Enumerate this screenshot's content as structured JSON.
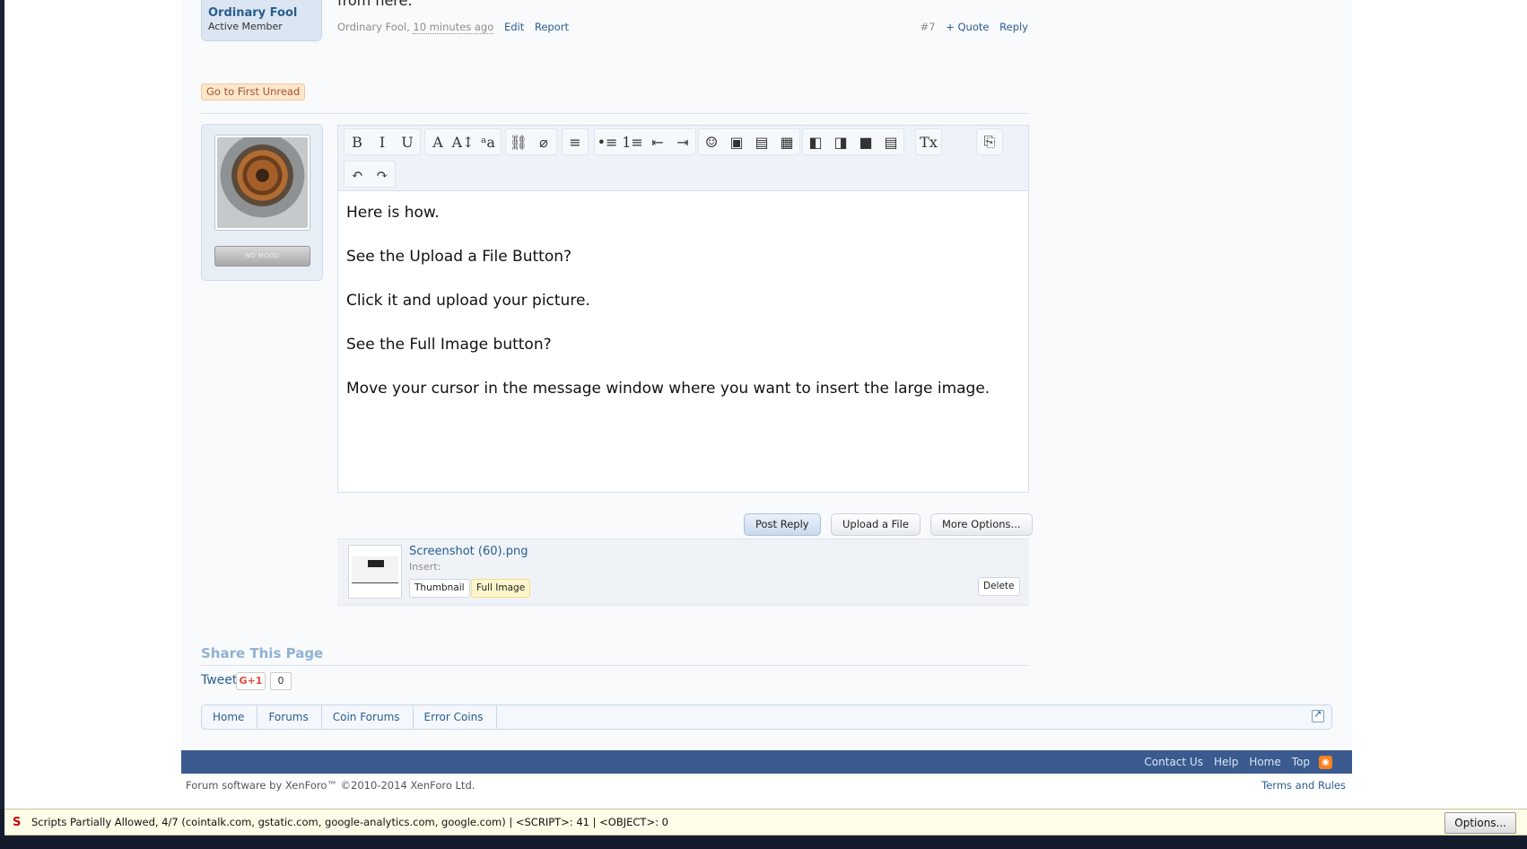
{
  "previous_post": {
    "username": "Ordinary Fool",
    "user_title": "Active Member",
    "cut_text": "from here.",
    "author": "Ordinary Fool,",
    "time": "10 minutes ago",
    "edit": "Edit",
    "report": "Report",
    "post_number": "#7",
    "quote": "+ Quote",
    "reply": "Reply"
  },
  "go_first_unread": "Go to First Unread",
  "quick_reply": {
    "mood_label": "NO MOOD",
    "toolbar_row1": [
      {
        "icon": "bold-icon",
        "glyph": "B"
      },
      {
        "icon": "italic-icon",
        "glyph": "I"
      },
      {
        "icon": "underline-icon",
        "glyph": "U"
      },
      {
        "icon": "text-color-icon",
        "glyph": "A"
      },
      {
        "icon": "font-size-icon",
        "glyph": "A↕"
      },
      {
        "icon": "font-family-icon",
        "glyph": "ᵃa"
      },
      {
        "icon": "link-icon",
        "glyph": "⛓"
      },
      {
        "icon": "unlink-icon",
        "glyph": "⌀"
      },
      {
        "icon": "align-icon",
        "glyph": "≡"
      },
      {
        "icon": "bullet-list-icon",
        "glyph": "•≡"
      },
      {
        "icon": "number-list-icon",
        "glyph": "1≡"
      },
      {
        "icon": "outdent-icon",
        "glyph": "⇤"
      },
      {
        "icon": "indent-icon",
        "glyph": "⇥"
      },
      {
        "icon": "smilie-icon",
        "glyph": "☺"
      },
      {
        "icon": "image-icon",
        "glyph": "▣"
      },
      {
        "icon": "media-icon",
        "glyph": "▤"
      },
      {
        "icon": "insert-icon",
        "glyph": "▦"
      },
      {
        "icon": "float-left-icon",
        "glyph": "◧"
      },
      {
        "icon": "float-right-icon",
        "glyph": "◨"
      },
      {
        "icon": "camera-icon",
        "glyph": "■"
      },
      {
        "icon": "save-draft-icon",
        "glyph": "▤"
      },
      {
        "icon": "remove-format-icon",
        "glyph": "Tx"
      },
      {
        "icon": "toggle-bbcode-icon",
        "glyph": "⎘"
      }
    ],
    "toolbar_row2": [
      {
        "icon": "undo-icon",
        "glyph": "↶"
      },
      {
        "icon": "redo-icon",
        "glyph": "↷"
      }
    ],
    "message_lines": [
      "Here is how.",
      "See the Upload a File Button?",
      "Click it and upload your picture.",
      "See the Full Image button?",
      "Move your cursor in the message window where you want to insert the large image."
    ],
    "post_reply": "Post Reply",
    "upload_file": "Upload a File",
    "more_options": "More Options..."
  },
  "attachment": {
    "filename": "Screenshot (60).png",
    "insert_label": "Insert:",
    "thumbnail_btn": "Thumbnail",
    "full_image_btn": "Full Image",
    "delete_btn": "Delete"
  },
  "share": {
    "title": "Share This Page",
    "tweet": "Tweet",
    "gplus": "G+1",
    "gplus_count": "0"
  },
  "breadcrumb": [
    "Home",
    "Forums",
    "Coin Forums",
    "Error Coins"
  ],
  "footer": {
    "links": [
      "Contact Us",
      "Help",
      "Home",
      "Top"
    ],
    "copyright": "Forum software by XenForo™ ©2010-2014 XenForo Ltd.",
    "terms": "Terms and Rules"
  },
  "noscript_bar": {
    "text": "Scripts Partially Allowed, 4/7 (cointalk.com, gstatic.com, google-analytics.com, google.com) | <SCRIPT>: 41 | <OBJECT>: 0",
    "options": "Options..."
  },
  "colors": {
    "accent": "#2a5d8f",
    "footer_bar": "#3b5a8f"
  }
}
